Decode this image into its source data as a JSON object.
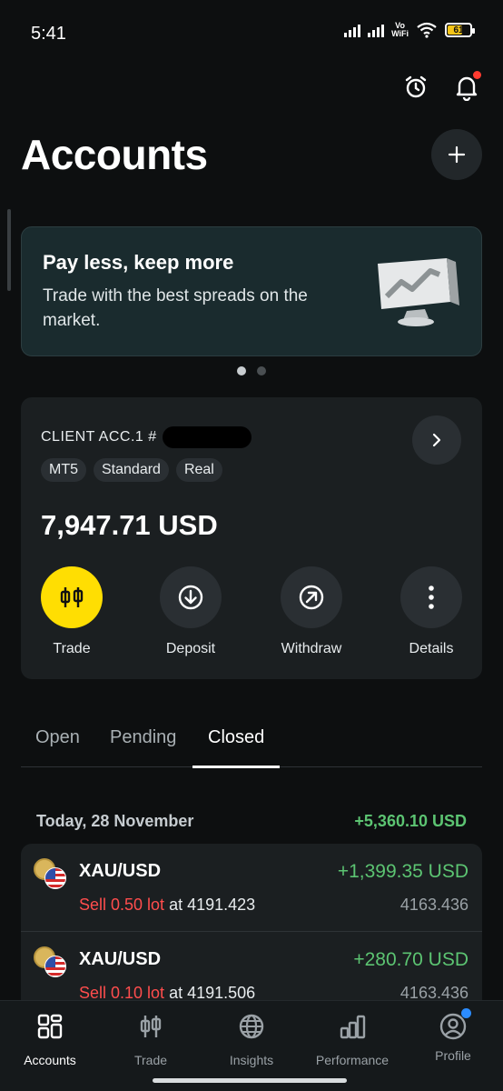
{
  "status_bar": {
    "time": "5:41",
    "wifi_label_1": "Vo",
    "wifi_label_2": "WiFi",
    "battery": "61"
  },
  "header": {
    "title": "Accounts",
    "icons": [
      "alarm-icon",
      "bell-icon",
      "plus-icon"
    ]
  },
  "promo": {
    "title": "Pay less, keep more",
    "body": "Trade with the best spreads on the market.",
    "slide_count": 2,
    "active_slide": 1
  },
  "account": {
    "name": "CLIENT ACC.1 #",
    "tags": [
      "MT5",
      "Standard",
      "Real"
    ],
    "balance": "7,947.71 USD",
    "actions": [
      {
        "label": "Trade",
        "icon": "candlestick-icon"
      },
      {
        "label": "Deposit",
        "icon": "arrow-down-circle-icon"
      },
      {
        "label": "Withdraw",
        "icon": "arrow-up-right-circle-icon"
      },
      {
        "label": "Details",
        "icon": "more-vertical-icon"
      }
    ]
  },
  "tabs": {
    "items": [
      "Open",
      "Pending",
      "Closed"
    ],
    "active": "Closed"
  },
  "closed": {
    "date_label": "Today, 28 November",
    "date_total": "+5,360.10 USD",
    "positions": [
      {
        "symbol": "XAU/USD",
        "pnl": "+1,399.35 USD",
        "side": "Sell 0.50 lot",
        "open_text": "at 4191.423",
        "current": "4163.436"
      },
      {
        "symbol": "XAU/USD",
        "pnl": "+280.70 USD",
        "side": "Sell 0.10 lot",
        "open_text": "at 4191.506",
        "current": "4163.436"
      }
    ]
  },
  "bottom_nav": {
    "items": [
      {
        "label": "Accounts",
        "icon": "grid-icon"
      },
      {
        "label": "Trade",
        "icon": "candlestick-icon"
      },
      {
        "label": "Insights",
        "icon": "globe-icon"
      },
      {
        "label": "Performance",
        "icon": "bar-chart-icon"
      },
      {
        "label": "Profile",
        "icon": "user-circle-icon"
      }
    ],
    "active": "Accounts"
  },
  "colors": {
    "accent": "#ffde02",
    "profit": "#5cc472",
    "sell": "#ff4d4d",
    "notification": "#ff3b30"
  }
}
